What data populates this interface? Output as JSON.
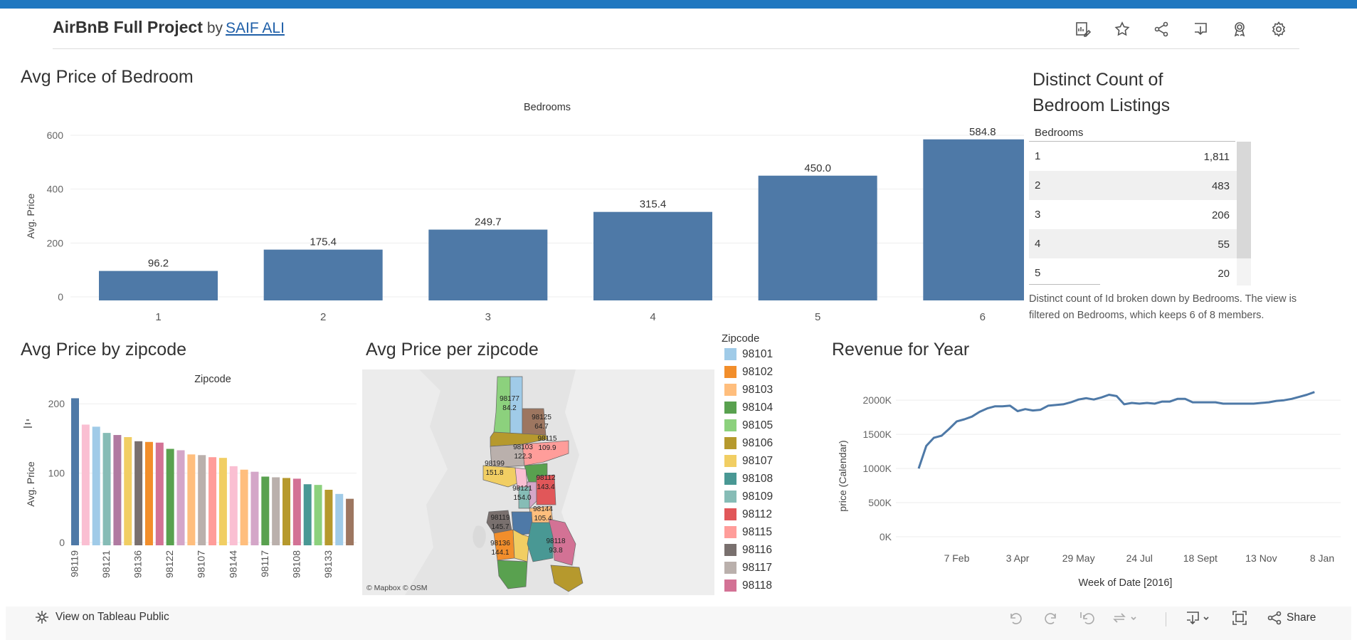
{
  "header": {
    "title": "AirBnB Full Project",
    "by": "by",
    "author": "SAIF ALI"
  },
  "toolbar_icons": [
    "edit-data-icon",
    "favorite-star-icon",
    "share-icon",
    "download-icon",
    "badge-icon",
    "settings-gear-icon"
  ],
  "bedroom_chart": {
    "title": "Avg Price of Bedroom",
    "chart_data": {
      "type": "bar",
      "header": "Bedrooms",
      "categories": [
        "1",
        "2",
        "3",
        "4",
        "5",
        "6"
      ],
      "values": [
        96.2,
        175.4,
        249.7,
        315.4,
        450.0,
        584.8
      ],
      "labels": [
        "96.2",
        "175.4",
        "249.7",
        "315.4",
        "450.0",
        "584.8"
      ],
      "ylabel": "Avg. Price",
      "yticks": [
        "0",
        "200",
        "400",
        "600"
      ],
      "ylim": [
        0,
        600
      ],
      "color": "#4e79a7"
    }
  },
  "listings": {
    "title_line1": "Distinct Count of",
    "title_line2": "Bedroom Listings",
    "column_header": "Bedrooms",
    "rows": [
      {
        "bedrooms": "1",
        "count": "1,811"
      },
      {
        "bedrooms": "2",
        "count": "483"
      },
      {
        "bedrooms": "3",
        "count": "206"
      },
      {
        "bedrooms": "4",
        "count": "55"
      },
      {
        "bedrooms": "5",
        "count": "20"
      }
    ],
    "note": "Distinct count of Id broken down by Bedrooms. The view is filtered on Bedrooms, which keeps 6 of 8 members."
  },
  "zip_chart": {
    "title": "Avg Price by zipcode",
    "chart_data": {
      "type": "bar",
      "header": "Zipcode",
      "ylabel": "Avg. Price",
      "yticks": [
        "0",
        "100",
        "200"
      ],
      "ylim": [
        0,
        230
      ],
      "values": [
        208,
        170,
        167,
        158,
        155,
        152,
        146,
        145,
        144,
        135,
        133,
        127,
        126,
        123,
        122,
        110,
        105,
        102,
        95,
        94,
        93,
        92,
        84,
        83,
        76,
        70,
        63
      ],
      "colors": [
        "#4e79a7",
        "#fabfd2",
        "#a0cbe8",
        "#86bcb6",
        "#b07aa1",
        "#f1ce63",
        "#79706e",
        "#f28e2b",
        "#d37295",
        "#59a14f",
        "#d4a6c8",
        "#ffbe7d",
        "#bab0ac",
        "#ff9d9a",
        "#f1ce63",
        "#fabfd2",
        "#ffbe7d",
        "#d4a6c8",
        "#59a14f",
        "#bab0ac",
        "#b6992d",
        "#d37295",
        "#499894",
        "#8cd17d",
        "#b6992d",
        "#a0cbe8",
        "#9d7660"
      ],
      "tick_labels": [
        {
          "i": 0,
          "text": "98119"
        },
        {
          "i": 3,
          "text": "98121"
        },
        {
          "i": 6,
          "text": "98136"
        },
        {
          "i": 9,
          "text": "98122"
        },
        {
          "i": 12,
          "text": "98107"
        },
        {
          "i": 15,
          "text": "98144"
        },
        {
          "i": 18,
          "text": "98117"
        },
        {
          "i": 21,
          "text": "98108"
        },
        {
          "i": 24,
          "text": "98133"
        }
      ]
    }
  },
  "map": {
    "title": "Avg Price per zipcode",
    "credits": "© Mapbox  © OSM",
    "labels": [
      {
        "zip": "98177",
        "value": "84.2"
      },
      {
        "zip": "98125",
        "value": "64.7"
      },
      {
        "zip": "98115",
        "value": "109.9"
      },
      {
        "zip": "98103",
        "value": "122.3"
      },
      {
        "zip": "98199",
        "value": "151.8"
      },
      {
        "zip": "98112",
        "value": "143.4"
      },
      {
        "zip": "98121",
        "value": "154.0"
      },
      {
        "zip": "98144",
        "value": "105.4"
      },
      {
        "zip": "98119",
        "value": "145.7"
      },
      {
        "zip": "98136",
        "value": "144.1"
      },
      {
        "zip": "98118",
        "value": "93.8"
      }
    ]
  },
  "legend": {
    "title": "Zipcode",
    "items": [
      {
        "label": "98101",
        "color": "#a0cbe8"
      },
      {
        "label": "98102",
        "color": "#f28e2b"
      },
      {
        "label": "98103",
        "color": "#ffbe7d"
      },
      {
        "label": "98104",
        "color": "#59a14f"
      },
      {
        "label": "98105",
        "color": "#8cd17d"
      },
      {
        "label": "98106",
        "color": "#b6992d"
      },
      {
        "label": "98107",
        "color": "#f1ce63"
      },
      {
        "label": "98108",
        "color": "#499894"
      },
      {
        "label": "98109",
        "color": "#86bcb6"
      },
      {
        "label": "98112",
        "color": "#e15759"
      },
      {
        "label": "98115",
        "color": "#ff9d9a"
      },
      {
        "label": "98116",
        "color": "#79706e"
      },
      {
        "label": "98117",
        "color": "#bab0ac"
      },
      {
        "label": "98118",
        "color": "#d37295"
      }
    ]
  },
  "revenue": {
    "title": "Revenue for Year",
    "chart_data": {
      "type": "line",
      "xlabel": "Week of Date [2016]",
      "ylabel": "price (Calendar)",
      "ylim": [
        0,
        2200000
      ],
      "yticks": [
        {
          "v": 0,
          "label": "0K"
        },
        {
          "v": 500000,
          "label": "500K"
        },
        {
          "v": 1000000,
          "label": "1000K"
        },
        {
          "v": 1500000,
          "label": "1500K"
        },
        {
          "v": 2000000,
          "label": "2000K"
        }
      ],
      "xticks": [
        {
          "w": 6,
          "label": "7 Feb"
        },
        {
          "w": 14,
          "label": "3 Apr"
        },
        {
          "w": 22,
          "label": "29 May"
        },
        {
          "w": 30,
          "label": "24 Jul"
        },
        {
          "w": 38,
          "label": "18 Sept"
        },
        {
          "w": 46,
          "label": "13 Nov"
        },
        {
          "w": 54,
          "label": "8 Jan"
        }
      ],
      "x_weeks": [
        1,
        2,
        3,
        4,
        5,
        6,
        7,
        8,
        9,
        10,
        11,
        12,
        13,
        14,
        15,
        16,
        17,
        18,
        19,
        20,
        21,
        22,
        23,
        24,
        25,
        26,
        27,
        28,
        29,
        30,
        31,
        32,
        33,
        34,
        35,
        36,
        37,
        38,
        39,
        40,
        41,
        42,
        43,
        44,
        45,
        46,
        47,
        48,
        49,
        50,
        51,
        52,
        53
      ],
      "values": [
        1000000,
        1330000,
        1450000,
        1480000,
        1580000,
        1690000,
        1720000,
        1760000,
        1830000,
        1880000,
        1910000,
        1910000,
        1920000,
        1840000,
        1870000,
        1850000,
        1860000,
        1920000,
        1930000,
        1940000,
        1970000,
        2010000,
        2030000,
        2010000,
        2040000,
        2080000,
        2060000,
        1940000,
        1960000,
        1950000,
        1960000,
        1950000,
        1980000,
        1980000,
        2020000,
        2020000,
        1970000,
        1970000,
        1970000,
        1970000,
        1950000,
        1950000,
        1950000,
        1950000,
        1950000,
        1960000,
        1970000,
        1990000,
        2000000,
        2020000,
        2050000,
        2080000,
        2120000
      ]
    }
  },
  "bottom": {
    "view_label": "View on Tableau Public",
    "share_label": "Share"
  }
}
